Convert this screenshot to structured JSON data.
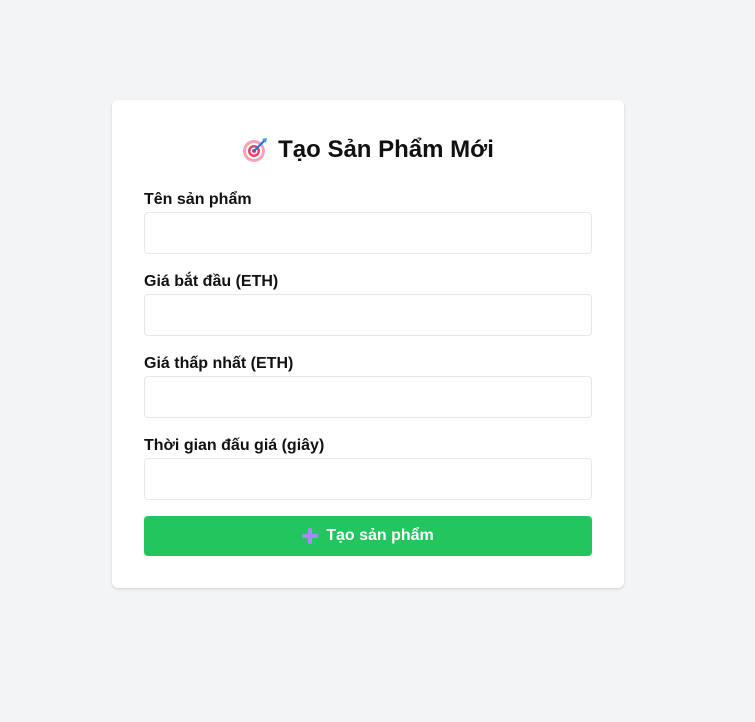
{
  "form": {
    "title": "Tạo Sản Phẩm Mới",
    "title_icon": "target-icon",
    "fields": [
      {
        "label": "Tên sản phẩm",
        "value": "",
        "placeholder": ""
      },
      {
        "label": "Giá bắt đầu (ETH)",
        "value": "",
        "placeholder": ""
      },
      {
        "label": "Giá thấp nhất (ETH)",
        "value": "",
        "placeholder": ""
      },
      {
        "label": "Thời gian đấu giá (giây)",
        "value": "",
        "placeholder": ""
      }
    ],
    "submit_label": "Tạo sản phẩm",
    "submit_icon": "plus-icon"
  },
  "colors": {
    "background": "#f3f4f6",
    "card": "#ffffff",
    "button": "#22c55e",
    "button_text": "#ffffff",
    "input_border": "#e5e7eb"
  }
}
